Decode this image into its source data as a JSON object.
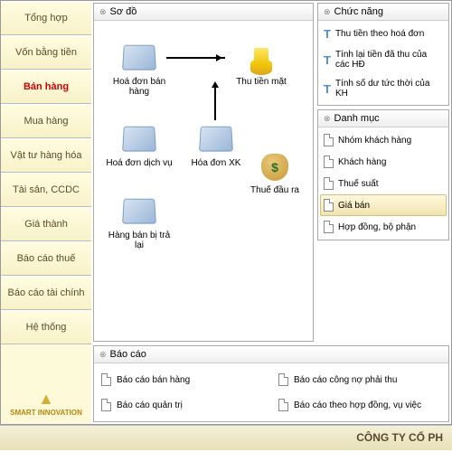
{
  "sidebar": {
    "items": [
      {
        "label": "Tổng hợp"
      },
      {
        "label": "Vốn bằng tiền"
      },
      {
        "label": "Bán hàng",
        "active": true
      },
      {
        "label": "Mua hàng"
      },
      {
        "label": "Vật tư hàng hóa"
      },
      {
        "label": "Tài sản, CCDC"
      },
      {
        "label": "Giá thành"
      },
      {
        "label": "Báo cáo thuế"
      },
      {
        "label": "Báo cáo tài chính"
      },
      {
        "label": "Hệ thống"
      }
    ],
    "logo_text": "SMART INNOVATION"
  },
  "diagram": {
    "title": "Sơ đồ",
    "nodes": {
      "hoadon_banhang": "Hoá đơn bán hàng",
      "thutienmat": "Thu tiền mặt",
      "hoadon_dichvu": "Hoá đơn dịch vụ",
      "hoadon_xk": "Hóa đơn XK",
      "hangban_tralai": "Hàng bán bị trả lại",
      "thue_daura": "Thuế đầu ra"
    }
  },
  "chucnang": {
    "title": "Chức năng",
    "items": [
      "Thu tiền theo hoá đơn",
      "Tính lại tiền đã thu của các HĐ",
      "Tính số dư tức thời của KH"
    ]
  },
  "danhmuc": {
    "title": "Danh mục",
    "items": [
      "Nhóm khách hàng",
      "Khách hàng",
      "Thuế suất",
      "Giá bán",
      "Hợp đồng, bộ phận"
    ],
    "selected": "Giá bán"
  },
  "baocao": {
    "title": "Báo cáo",
    "items": [
      "Báo cáo bán hàng",
      "Báo cáo công nợ phải thu",
      "Báo cáo quản trị",
      "Báo cáo theo hợp đồng, vụ việc"
    ]
  },
  "footer": "CÔNG TY CỔ PH"
}
